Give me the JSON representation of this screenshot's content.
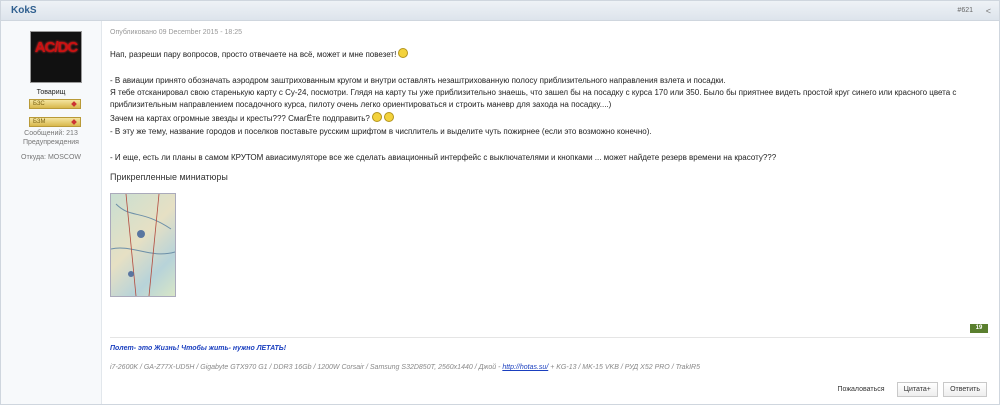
{
  "header": {
    "author": "KokS",
    "post_number": "#621",
    "share_glyph": "<"
  },
  "sidebar": {
    "avatar_text": "AC/DC",
    "rank": "Товарищ",
    "badges": [
      "БЗС",
      "БЗМ"
    ],
    "messages": "Сообщений: 213",
    "warnings": "Предупреждения",
    "location_label": "Откуда:",
    "location": "MOSCOW"
  },
  "post": {
    "published": "Опубликовано 09 December 2015 - 18:25",
    "lines": [
      "Нап, разреши пару вопросов, просто отвечаете на всё, может и мне повезет!",
      "- В авиации принято обозначать аэродром заштрихованным кругом и внутри оставлять незаштрихованную полосу приблизительного направления взлета и посадки.",
      "Я тебе отсканировал свою старенькую карту с Су-24, посмотри. Глядя на карту ты  уже приблизительно знаешь, что зашел бы на посадку с курса 170 или 350.  Было бы приятнее видеть простой круг синего или красного цвета с",
      "приблизительным направлением посадочного курса, пилоту очень легко ориентироваться и строить маневр для захода на посадку....)",
      "Зачем на картах огромные звезды и кресты??? СмагЁте подправить?",
      "- В эту же тему,  название городов и поселков поставьте  русским  шрифтом в чисплитель  и выделите чуть пожирнее (если это возможно конечно).",
      "- И  еще, есть ли планы в самом КРУТОМ  авиасимуляторе все же сделать авиационный интерфейс с выключателями и кнопками ... может найдете резерв времени на красоту???"
    ],
    "attachments_title": "Прикрепленные миниатюры",
    "likes": "19"
  },
  "signature": {
    "motto": "Полет- это Жизнь!  Чтобы жить- нужно ЛЕТАТЬ!",
    "specs_before": "i7-2600K / GA-Z77X-UD5H  / Gigabyte GTX970 G1 / DDR3 16Gb / 1200W Corsair / Samsung S32D850T, 2560х1440 / Джой - ",
    "specs_link": "http://hotas.su/",
    "specs_after": "  + KG-13 / MK-15 VKB / РУД X52 PRO  / TrakIR5"
  },
  "actions": {
    "report": "Пожаловаться",
    "quote": "Цитата+",
    "reply": "Ответить"
  },
  "colors": {
    "author": "#2f5f8f",
    "signature": "#1a3fbf",
    "likes_badge": "#5a7f2e"
  }
}
